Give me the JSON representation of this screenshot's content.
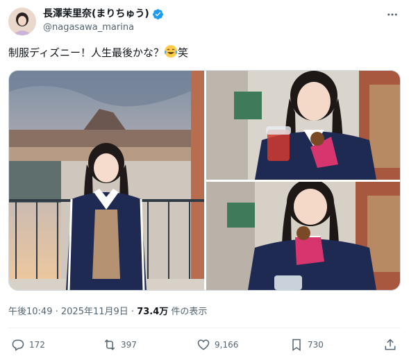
{
  "user": {
    "display_name": "長澤茉里奈(まりちゅう)",
    "handle": "@nagasawa_marina",
    "verified": true
  },
  "tweet": {
    "text_before": "制服ディズニー！人生最後かな？",
    "emoji_name": "laughing-crying-emoji",
    "text_after": "笑"
  },
  "media": {
    "count": 3
  },
  "meta": {
    "time": "午後10:49",
    "separator": " · ",
    "date": "2025年11月9日",
    "views": "73.4万",
    "views_suffix": " 件の表示"
  },
  "actions": {
    "replies": "172",
    "reposts": "397",
    "likes": "9,166",
    "bookmarks": "730"
  },
  "colors": {
    "text_primary": "#0f1419",
    "text_secondary": "#536471",
    "verified": "#1d9bf0"
  }
}
